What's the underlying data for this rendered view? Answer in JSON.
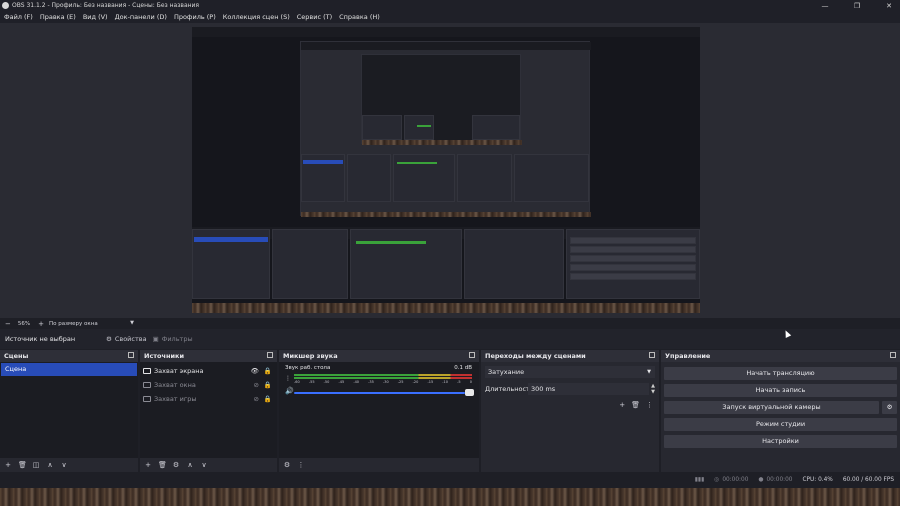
{
  "window": {
    "title": "OBS 31.1.2 - Профиль: Без названия - Сцены: Без названия",
    "minimize": "—",
    "maximize": "❐",
    "close": "✕"
  },
  "menu": [
    "Файл (F)",
    "Правка (E)",
    "Вид (V)",
    "Док-панели (D)",
    "Профиль (P)",
    "Коллекция сцен (S)",
    "Сервис (T)",
    "Справка (H)"
  ],
  "zoom": {
    "minus": "−",
    "value": "56%",
    "plus": "+",
    "mode": "По размеру окна"
  },
  "source_toolbar": {
    "label": "Источник не выбран",
    "properties": "Свойства",
    "filters": "Фильтры"
  },
  "scenes": {
    "title": "Сцены",
    "items": [
      "Сцена"
    ]
  },
  "sources": {
    "title": "Источники",
    "items": [
      {
        "label": "Захват экрана",
        "visible": true
      },
      {
        "label": "Захват окна",
        "visible": false
      },
      {
        "label": "Захват игры",
        "visible": false
      }
    ]
  },
  "mixer": {
    "title": "Микшер звука",
    "channel": "Звук раб. стола",
    "db": "0.1 dB",
    "ticks": [
      "-60",
      "-55",
      "-50",
      "-45",
      "-40",
      "-35",
      "-30",
      "-25",
      "-20",
      "-15",
      "-10",
      "-5",
      "0"
    ]
  },
  "transitions": {
    "title": "Переходы между сценами",
    "type": "Затухание",
    "duration_label": "Длительность",
    "duration_value": "300 ms"
  },
  "controls": {
    "title": "Управление",
    "buttons": [
      "Начать трансляцию",
      "Начать запись",
      "Запуск виртуальной камеры",
      "Режим студии",
      "Настройки"
    ]
  },
  "status": {
    "stream_time": "00:00:00",
    "rec_time": "00:00:00",
    "cpu": "CPU: 0.4%",
    "fps": "60.00 / 60.00 FPS"
  },
  "colors": {
    "accent": "#284cb8",
    "meter_green": "#3aa23a",
    "meter_yellow": "#b9a22a",
    "meter_red": "#c03030",
    "slider": "#3a6fff"
  }
}
